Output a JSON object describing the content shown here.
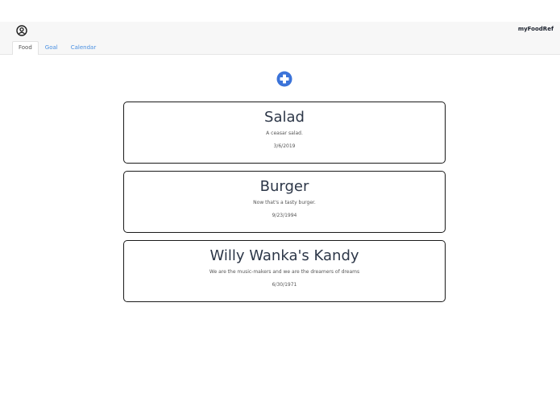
{
  "app": {
    "name": "myFoodRef",
    "user_icon": "user-circle-icon"
  },
  "tabs": [
    {
      "label": "Food",
      "active": true
    },
    {
      "label": "Goal",
      "active": false
    },
    {
      "label": "Calendar",
      "active": false
    }
  ],
  "add_button": {
    "icon": "plus-circle-icon",
    "color": "#3b73d9"
  },
  "foods": [
    {
      "title": "Salad",
      "description": "A ceasar salad.",
      "date": "3/6/2019"
    },
    {
      "title": "Burger",
      "description": "Now that's a tasty burger.",
      "date": "9/23/1994"
    },
    {
      "title": "Willy Wanka's Kandy",
      "description": "We are the music-makers and we are the dreamers of dreams",
      "date": "6/30/1971"
    }
  ]
}
